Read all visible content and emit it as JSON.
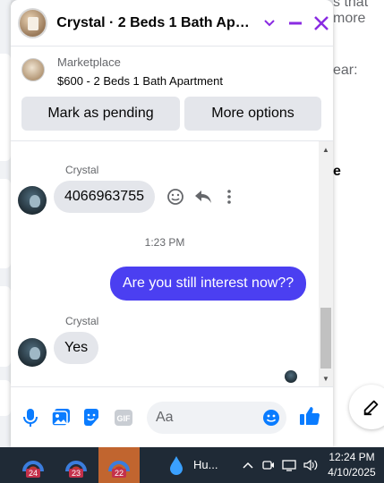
{
  "background": {
    "text_top": "s that",
    "text_more": "more",
    "text_year": "ear:",
    "text_e": "e"
  },
  "chat": {
    "title": "Crystal · 2 Beds 1 Bath Apa…",
    "listing": {
      "source": "Marketplace",
      "title": "$600 - 2 Beds 1 Bath Apartment",
      "mark_pending_label": "Mark as pending",
      "more_options_label": "More options"
    },
    "messages": {
      "sender_1": "Crystal",
      "msg_1": "4066963755",
      "timestamp": "1:23 PM",
      "msg_out": "Are you still interest now??",
      "sender_2": "Crystal",
      "msg_2": "Yes"
    },
    "composer": {
      "placeholder": "Aa"
    }
  },
  "taskbar": {
    "apps": [
      {
        "badge": "24"
      },
      {
        "badge": "23"
      },
      {
        "badge": "22"
      }
    ],
    "weather_label": "Hu...",
    "time": "12:24 PM",
    "date": "4/10/2025"
  },
  "colors": {
    "accent": "#4b3ff1",
    "header_icons": "#8a2be2",
    "messenger_blue": "#0a7cff"
  }
}
